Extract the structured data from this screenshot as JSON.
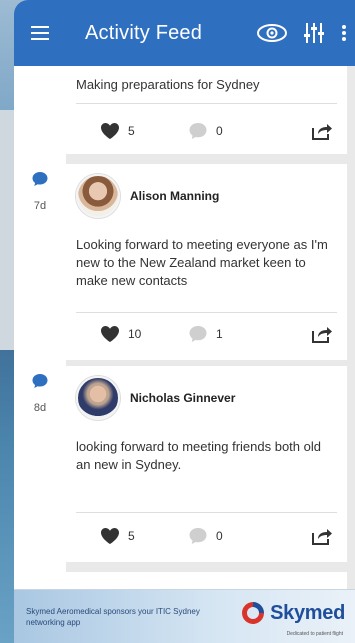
{
  "header": {
    "title": "Activity Feed",
    "icons": [
      "menu-icon",
      "eye-icon",
      "filter-sliders-icon",
      "more-vertical-icon"
    ]
  },
  "colors": {
    "appbar": "#2f6fc0",
    "timeline_dot": "#2f6fc0",
    "icon_dark": "#333333"
  },
  "timeline": [
    {
      "age": "7d"
    },
    {
      "age": "8d"
    }
  ],
  "posts": [
    {
      "text": "Making preparations for Sydney",
      "likes": "5",
      "comments": "0"
    },
    {
      "author": "Alison Manning",
      "text": "Looking forward to meeting everyone as I'm new to the New Zealand market keen to make new contacts",
      "likes": "10",
      "comments": "1"
    },
    {
      "author": "Nicholas Ginnever",
      "text": "looking forward to meeting friends both old an new in Sydney.",
      "likes": "5",
      "comments": "0"
    }
  ],
  "banner": {
    "message": "Skymed Aeromedical sponsors your ITIC Sydney networking app",
    "logo": "Skymed",
    "tagline": "Dedicated to patient flight"
  }
}
